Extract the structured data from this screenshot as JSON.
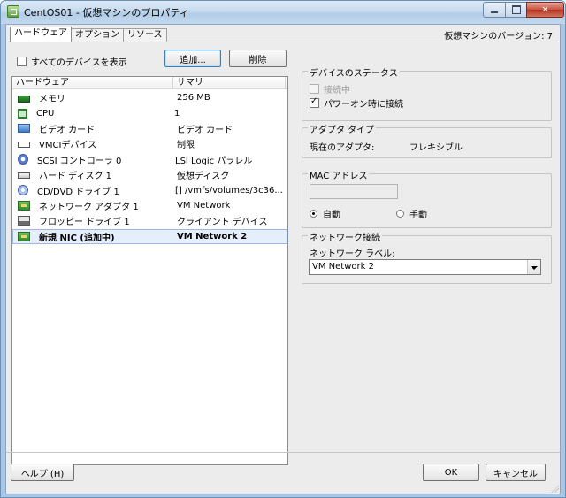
{
  "window": {
    "title": "CentOS01 - 仮想マシンのプロパティ"
  },
  "tabs": [
    {
      "label": "ハードウェア",
      "active": true
    },
    {
      "label": "オプション",
      "active": false
    },
    {
      "label": "リソース",
      "active": false
    }
  ],
  "version_label": "仮想マシンのバージョン: 7",
  "hardware": {
    "show_all_label": "すべてのデバイスを表示",
    "show_all_checked": false,
    "add_button": "追加...",
    "remove_button": "削除",
    "columns": [
      "ハードウェア",
      "サマリ"
    ],
    "items": [
      {
        "icon": "memory-icon",
        "name": "メモリ",
        "summary": "256 MB"
      },
      {
        "icon": "cpu-icon",
        "name": "CPU",
        "summary": "1"
      },
      {
        "icon": "video-card-icon",
        "name": "ビデオ カード",
        "summary": "ビデオ カード"
      },
      {
        "icon": "vmci-device-icon",
        "name": "VMCIデバイス",
        "summary": "制限"
      },
      {
        "icon": "scsi-controller-icon",
        "name": "SCSI コントローラ 0",
        "summary": "LSI Logic パラレル"
      },
      {
        "icon": "hard-disk-icon",
        "name": "ハード ディスク 1",
        "summary": "仮想ディスク"
      },
      {
        "icon": "cd-dvd-icon",
        "name": "CD/DVD ドライブ 1",
        "summary": "[] /vmfs/volumes/3c36..."
      },
      {
        "icon": "network-adapter-icon",
        "name": "ネットワーク アダプタ 1",
        "summary": "VM Network"
      },
      {
        "icon": "floppy-icon",
        "name": "フロッピー ドライブ 1",
        "summary": "クライアント デバイス"
      },
      {
        "icon": "network-adapter-icon",
        "name": "新規 NIC (追加中)",
        "summary": "VM Network 2",
        "selected": true
      }
    ]
  },
  "device_status": {
    "title": "デバイスのステータス",
    "connected_label": "接続中",
    "connected_checked": false,
    "connect_at_power_on_label": "パワーオン時に接続",
    "connect_at_power_on_checked": true
  },
  "adapter_type": {
    "title": "アダプタ タイプ",
    "current_label": "現在のアダプタ:",
    "current_value": "フレキシブル"
  },
  "mac_address": {
    "title": "MAC アドレス",
    "value": "",
    "auto_label": "自動",
    "manual_label": "手動",
    "selected": "auto"
  },
  "network_connection": {
    "title": "ネットワーク接続",
    "label": "ネットワーク ラベル:",
    "selected_value": "VM Network 2"
  },
  "footer": {
    "help_button": "ヘルプ (H)",
    "ok_button": "OK",
    "cancel_button": "キャンセル"
  }
}
